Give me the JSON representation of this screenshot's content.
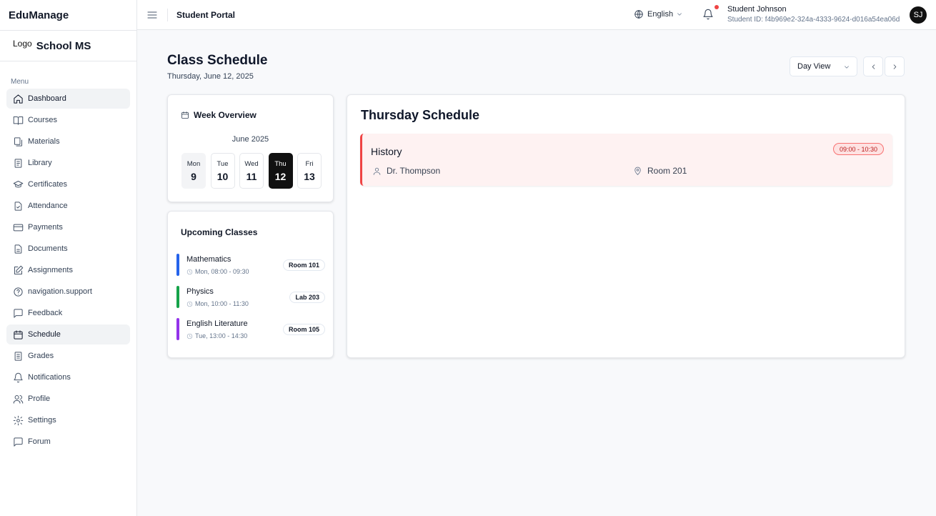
{
  "app": {
    "name": "EduManage",
    "logo_text": "Logo",
    "school_name": "School MS"
  },
  "sidebar": {
    "menu_label": "Menu",
    "items": [
      {
        "label": "Dashboard",
        "icon": "home-icon",
        "active": true
      },
      {
        "label": "Courses",
        "icon": "book-open-icon"
      },
      {
        "label": "Materials",
        "icon": "files-icon"
      },
      {
        "label": "Library",
        "icon": "book-icon"
      },
      {
        "label": "Certificates",
        "icon": "graduation-cap-icon"
      },
      {
        "label": "Attendance",
        "icon": "file-check-icon"
      },
      {
        "label": "Payments",
        "icon": "credit-card-icon"
      },
      {
        "label": "Documents",
        "icon": "file-text-icon"
      },
      {
        "label": "Assignments",
        "icon": "edit-icon"
      },
      {
        "label": "navigation.support",
        "icon": "help-circle-icon"
      },
      {
        "label": "Feedback",
        "icon": "message-square-icon"
      },
      {
        "label": "Schedule",
        "icon": "calendar-icon",
        "active": true
      },
      {
        "label": "Grades",
        "icon": "clipboard-icon"
      },
      {
        "label": "Notifications",
        "icon": "bell-icon"
      },
      {
        "label": "Profile",
        "icon": "users-icon"
      },
      {
        "label": "Settings",
        "icon": "gear-icon"
      },
      {
        "label": "Forum",
        "icon": "message-square-icon"
      }
    ]
  },
  "header": {
    "title": "Student Portal",
    "language": "English",
    "user": {
      "name": "Student Johnson",
      "id_text": "Student ID: f4b969e2-324a-4333-9624-d016a54ea06d",
      "initials": "SJ"
    }
  },
  "page": {
    "title": "Class Schedule",
    "date": "Thursday, June 12, 2025",
    "view_select": "Day View"
  },
  "week": {
    "title": "Week Overview",
    "month": "June 2025",
    "days": [
      {
        "name": "Mon",
        "date": "9"
      },
      {
        "name": "Tue",
        "date": "10"
      },
      {
        "name": "Wed",
        "date": "11"
      },
      {
        "name": "Thu",
        "date": "12"
      },
      {
        "name": "Fri",
        "date": "13"
      }
    ]
  },
  "upcoming": {
    "title": "Upcoming Classes",
    "items": [
      {
        "name": "Mathematics",
        "time": "Mon, 08:00 - 09:30",
        "room": "Room 101",
        "color": "#2563eb"
      },
      {
        "name": "Physics",
        "time": "Mon, 10:00 - 11:30",
        "room": "Lab 203",
        "color": "#16a34a"
      },
      {
        "name": "English Literature",
        "time": "Tue, 13:00 - 14:30",
        "room": "Room 105",
        "color": "#9333ea"
      }
    ]
  },
  "schedule": {
    "title": "Thursday Schedule",
    "events": [
      {
        "name": "History",
        "time": "09:00 - 10:30",
        "teacher": "Dr. Thompson",
        "room": "Room 201",
        "color": "#ef4444"
      }
    ]
  }
}
